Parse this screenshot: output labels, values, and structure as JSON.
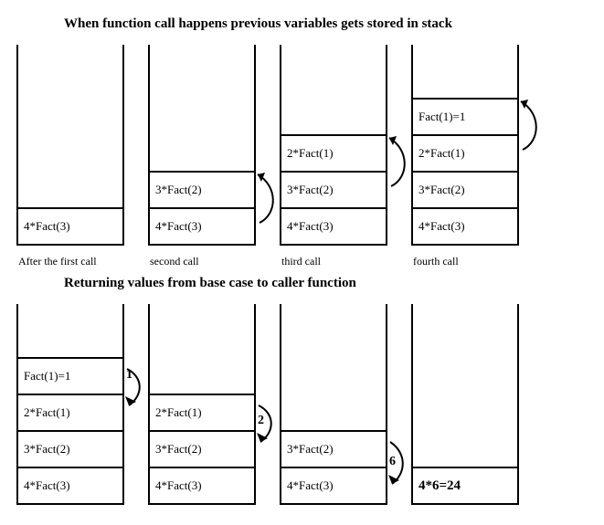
{
  "titles": {
    "push": "When function call happens previous variables gets stored in stack",
    "pop": "Returning values from base case to caller function"
  },
  "frames": {
    "f4": "4*Fact(3)",
    "f3": "3*Fact(2)",
    "f2": "2*Fact(1)",
    "f1": "Fact(1)=1"
  },
  "captions": {
    "c1": "After the first call",
    "c2": "second call",
    "c3": "third call",
    "c4": "fourth call"
  },
  "returns": {
    "r1": "1",
    "r2": "2",
    "r6": "6"
  },
  "result": "4*6=24"
}
